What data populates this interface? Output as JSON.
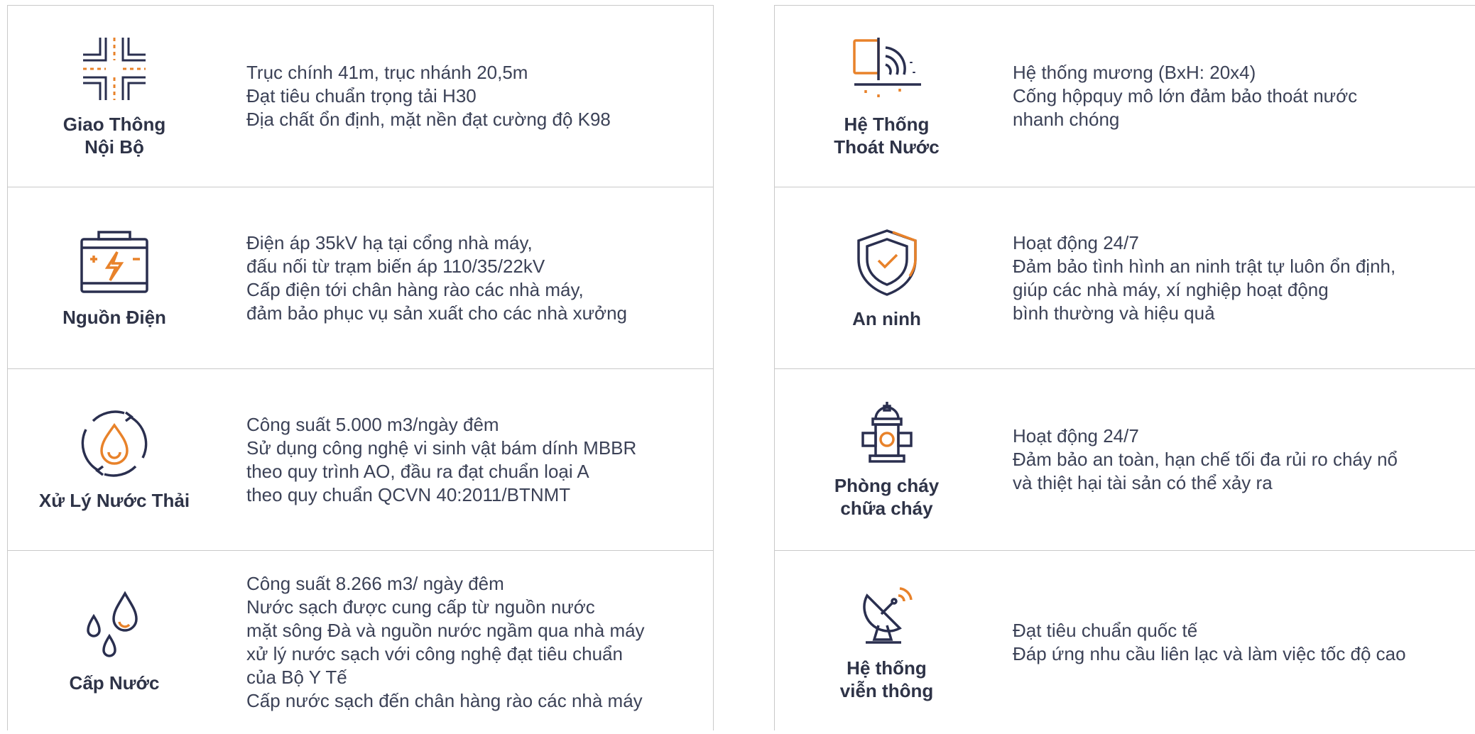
{
  "colors": {
    "navy": "#2a2f4f",
    "orange": "#e8822a",
    "border": "#c9c9c9"
  },
  "left": [
    {
      "icon": "intersection-icon",
      "title_lines": [
        "Giao Thông",
        "Nội Bộ"
      ],
      "lines": [
        "Trục chính 41m, trục nhánh 20,5m",
        "Đạt tiêu chuẩn trọng tải H30",
        "Địa chất ổn định, mặt nền đạt cường độ K98"
      ]
    },
    {
      "icon": "battery-icon",
      "title_lines": [
        "Nguồn Điện"
      ],
      "lines": [
        "Điện áp 35kV hạ tại cổng nhà máy,",
        "đấu nối từ trạm biến áp 110/35/22kV",
        "Cấp điện tới chân hàng rào các nhà máy,",
        "đảm bảo phục vụ sản xuất cho các nhà xưởng"
      ]
    },
    {
      "icon": "water-recycle-icon",
      "title_lines": [
        "Xử Lý Nước Thải"
      ],
      "lines": [
        "Công suất 5.000 m3/ngày đêm",
        "Sử dụng công nghệ vi sinh vật bám dính MBBR",
        "theo quy trình AO, đầu ra đạt chuẩn loại A",
        "theo quy chuẩn QCVN 40:2011/BTNMT"
      ]
    },
    {
      "icon": "water-drops-icon",
      "title_lines": [
        "Cấp Nước"
      ],
      "lines": [
        "Công suất 8.266 m3/ ngày đêm",
        "Nước sạch được cung cấp từ nguồn nước",
        "mặt sông Đà và nguồn nước ngầm qua nhà máy",
        "xử lý nước sạch với công nghệ đạt tiêu chuẩn",
        "của Bộ Y Tế",
        "Cấp nước sạch đến chân hàng rào các nhà máy"
      ]
    }
  ],
  "right": [
    {
      "icon": "drainage-icon",
      "title_lines": [
        "Hệ Thống",
        "Thoát Nước"
      ],
      "lines": [
        "Hệ thống mương (BxH: 20x4)",
        "Cống hộpquy mô lớn đảm bảo thoát nước",
        "nhanh chóng"
      ]
    },
    {
      "icon": "shield-check-icon",
      "title_lines": [
        "An ninh"
      ],
      "lines": [
        "Hoạt động 24/7",
        "Đảm bảo tình hình an ninh trật tự luôn ổn định,",
        "giúp các nhà máy, xí nghiệp hoạt động",
        "bình thường và hiệu quả"
      ]
    },
    {
      "icon": "fire-hydrant-icon",
      "title_lines": [
        "Phòng cháy",
        "chữa cháy"
      ],
      "lines": [
        "Hoạt động 24/7",
        "Đảm bảo an toàn, hạn chế tối đa rủi ro cháy nổ",
        "và thiệt hại tài sản có thể xảy ra"
      ]
    },
    {
      "icon": "satellite-dish-icon",
      "title_lines": [
        "Hệ thống",
        "viễn thông"
      ],
      "lines": [
        "Đạt tiêu chuẩn quốc tế",
        "Đáp ứng nhu cầu liên lạc và làm việc tốc độ cao"
      ]
    }
  ]
}
